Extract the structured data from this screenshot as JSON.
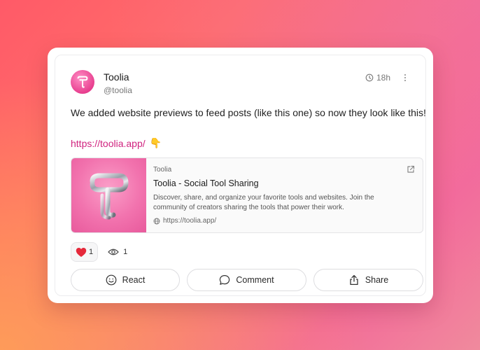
{
  "post": {
    "author_name": "Toolia",
    "author_handle": "@toolia",
    "time": "18h",
    "text": "We added website previews to feed posts (like this one) so now they look like this!",
    "link": "https://toolia.app/",
    "link_emoji": "👇"
  },
  "preview": {
    "site": "Toolia",
    "title": "Toolia - Social Tool Sharing",
    "description_line1": "Discover, share, and organize your favorite tools and websites. Join the",
    "description_line2": "community of creators sharing the tools that power their work.",
    "url": "https://toolia.app/"
  },
  "reactions": {
    "heart_count": "1",
    "view_count": "1"
  },
  "actions": {
    "react_label": "React",
    "comment_label": "Comment",
    "share_label": "Share"
  },
  "icons": {
    "clock": "clock-icon",
    "more": "more-vertical-icon",
    "external": "external-link-icon",
    "globe": "globe-icon",
    "heart": "heart-icon",
    "eye": "eye-icon",
    "smile": "smile-icon",
    "comment": "comment-bubble-icon",
    "share": "share-upload-icon"
  },
  "colors": {
    "link": "#d0237f",
    "avatar_bg": "#e83f8f",
    "heart": "#e5283a"
  }
}
